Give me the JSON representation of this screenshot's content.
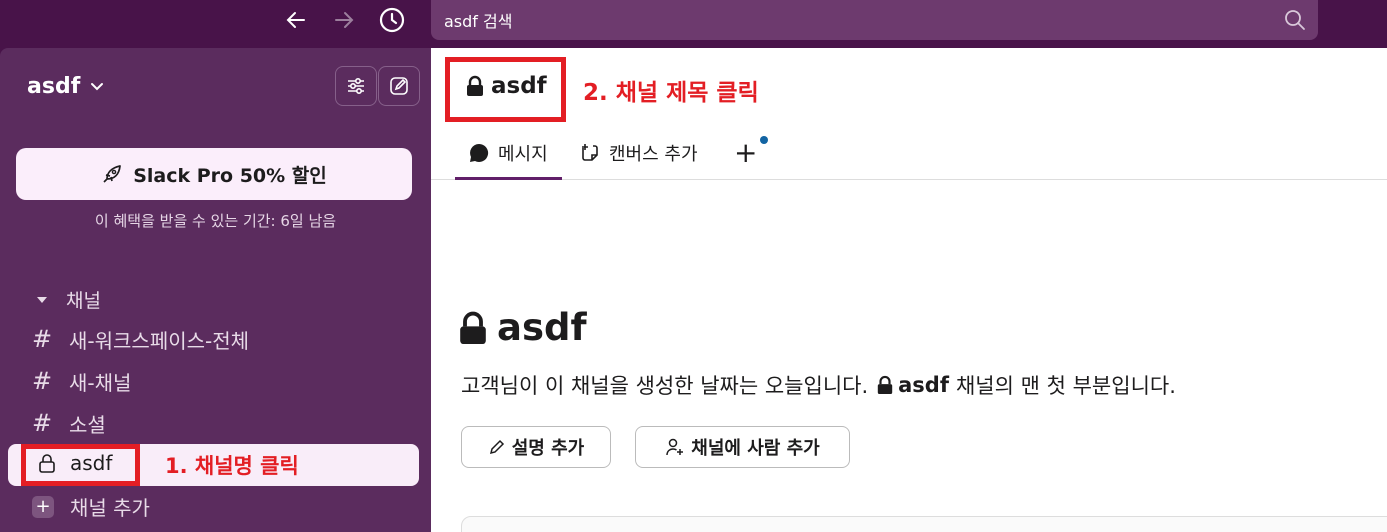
{
  "topbar": {
    "search_text": "asdf 검색"
  },
  "sidebar": {
    "workspace_name": "asdf",
    "promo_label": "Slack Pro 50% 할인",
    "promo_note": "이 혜택을 받을 수 있는 기간: 6일 남음",
    "section_label": "채널",
    "channels": [
      {
        "name": "새-워크스페이스-전체"
      },
      {
        "name": "새-채널"
      },
      {
        "name": "소셜"
      }
    ],
    "active_channel": "asdf",
    "add_channel_label": "채널 추가",
    "annotation_1": "1. 채널명 클릭"
  },
  "main": {
    "channel_title": "asdf",
    "annotation_2": "2. 채널 제목 클릭",
    "tabs": {
      "messages": "메시지",
      "canvas": "캔버스 추가"
    },
    "intro_title": "asdf",
    "intro_text_pre": "고객님이 이 채널을 생성한 날짜는 오늘입니다.",
    "intro_channel": "asdf",
    "intro_text_post": "채널의 맨 첫 부분입니다.",
    "btn_description": "설명 추가",
    "btn_add_people": "채널에 사람 추가"
  },
  "colors": {
    "topbar_bg": "#481349",
    "sidebar_bg": "#5b2c5e",
    "accent": "#611f69",
    "annotation_red": "#e31e24"
  }
}
